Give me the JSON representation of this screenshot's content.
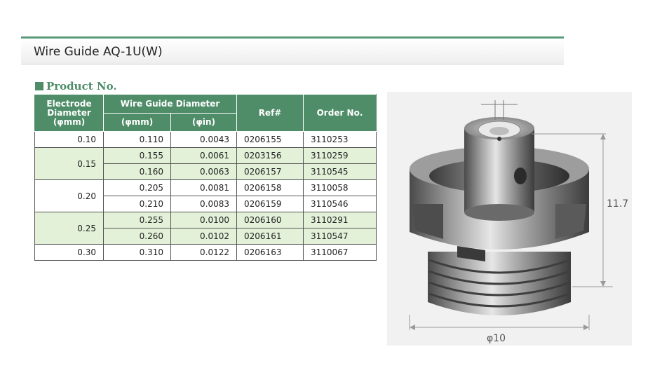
{
  "page": {
    "title": "Wire Guide AQ-1U(W)"
  },
  "section": {
    "heading": "Product No."
  },
  "table": {
    "headers": {
      "electrode_diameter": [
        "Electrode",
        "Diameter",
        "(φmm)"
      ],
      "wire_guide_diameter": "Wire Guide Diameter",
      "wg_mm": "(φmm)",
      "wg_in": "(φin)",
      "ref": "Ref#",
      "order": "Order No."
    },
    "groups": [
      {
        "electrode": "0.10",
        "rows": [
          {
            "mm": "0.110",
            "in": "0.0043",
            "ref": "0206155",
            "order": "3110253"
          }
        ]
      },
      {
        "electrode": "0.15",
        "rows": [
          {
            "mm": "0.155",
            "in": "0.0061",
            "ref": "0203156",
            "order": "3110259"
          },
          {
            "mm": "0.160",
            "in": "0.0063",
            "ref": "0206157",
            "order": "3110545"
          }
        ]
      },
      {
        "electrode": "0.20",
        "rows": [
          {
            "mm": "0.205",
            "in": "0.0081",
            "ref": "0206158",
            "order": "3110058"
          },
          {
            "mm": "0.210",
            "in": "0.0083",
            "ref": "0206159",
            "order": "3110546"
          }
        ]
      },
      {
        "electrode": "0.25",
        "rows": [
          {
            "mm": "0.255",
            "in": "0.0100",
            "ref": "0206160",
            "order": "3110291"
          },
          {
            "mm": "0.260",
            "in": "0.0102",
            "ref": "0206161",
            "order": "3110547"
          }
        ]
      },
      {
        "electrode": "0.30",
        "rows": [
          {
            "mm": "0.310",
            "in": "0.0122",
            "ref": "0206163",
            "order": "3110067"
          }
        ]
      }
    ]
  },
  "figure": {
    "height_dim": "11.7",
    "diameter_dim": "φ10"
  },
  "colors": {
    "header_green": "#4e8d68",
    "row_green": "#e3f1d8",
    "title_rule": "#5b9b7c"
  }
}
